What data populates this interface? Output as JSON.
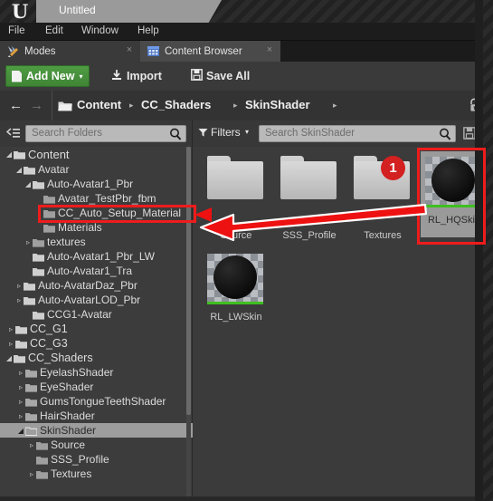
{
  "window": {
    "logo_icon": "unreal-engine-logo",
    "project_tab_title": "Untitled"
  },
  "menu": {
    "items": [
      {
        "label": "File"
      },
      {
        "label": "Edit"
      },
      {
        "label": "Window"
      },
      {
        "label": "Help"
      }
    ]
  },
  "panel_tabs": [
    {
      "label": "Modes",
      "icon": "modes-brush-icon",
      "active": false,
      "close_glyph": "×"
    },
    {
      "label": "Content Browser",
      "icon": "content-browser-grid-icon",
      "active": true,
      "close_glyph": "×"
    }
  ],
  "toolbar": {
    "add_new_label": "Add New",
    "add_new_caret": "▾",
    "import_label": "Import",
    "save_all_label": "Save All"
  },
  "breadcrumb": {
    "back_glyph": "←",
    "forward_glyph": "→",
    "separator": "▸",
    "items": [
      "Content",
      "CC_Shaders",
      "SkinShader"
    ],
    "lock_icon": "padlock-unlocked-icon"
  },
  "folder_search": {
    "placeholder": "Search Folders",
    "tree_toggle_icon": "tree-expand-icon",
    "search_icon": "search-icon"
  },
  "asset_search": {
    "filters_label": "Filters",
    "filters_caret": "▾",
    "filter_icon": "funnel-icon",
    "placeholder": "Search SkinShader",
    "search_icon": "search-icon",
    "save_search_icon": "save-floppy-icon"
  },
  "tree": {
    "items": [
      {
        "label": "Content",
        "depth": 0,
        "twisty": "◢",
        "selected": false
      },
      {
        "label": "Avatar",
        "depth": 1,
        "twisty": "◢",
        "selected": false
      },
      {
        "label": "Auto-Avatar1_Pbr",
        "depth": 2,
        "twisty": "◢",
        "selected": false
      },
      {
        "label": "Avatar_TestPbr_fbm",
        "depth": 3,
        "twisty": "",
        "selected": false
      },
      {
        "label": "CC_Auto_Setup_Material",
        "depth": 3,
        "twisty": "",
        "selected": false,
        "highlighted": true
      },
      {
        "label": "Materials",
        "depth": 3,
        "twisty": "",
        "selected": false
      },
      {
        "label": "textures",
        "depth": 3,
        "twisty": "▹",
        "selected": false
      },
      {
        "label": "Auto-Avatar1_Pbr_LW",
        "depth": 2,
        "twisty": "",
        "selected": false
      },
      {
        "label": "Auto-Avatar1_Tra",
        "depth": 2,
        "twisty": "",
        "selected": false
      },
      {
        "label": "Auto-AvatarDaz_Pbr",
        "depth": 2,
        "twisty": "▹",
        "selected": false
      },
      {
        "label": "Auto-AvatarLOD_Pbr",
        "depth": 2,
        "twisty": "▹",
        "selected": false
      },
      {
        "label": "CCG1-Avatar",
        "depth": 2,
        "twisty": "",
        "selected": false
      },
      {
        "label": "CC_G1",
        "depth": 1,
        "twisty": "▹",
        "selected": false
      },
      {
        "label": "CC_G3",
        "depth": 1,
        "twisty": "▹",
        "selected": false
      },
      {
        "label": "CC_Shaders",
        "depth": 1,
        "twisty": "◢",
        "selected": false
      },
      {
        "label": "EyelashShader",
        "depth": 2,
        "twisty": "▹",
        "selected": false
      },
      {
        "label": "EyeShader",
        "depth": 2,
        "twisty": "▹",
        "selected": false
      },
      {
        "label": "GumsTongueTeethShader",
        "depth": 2,
        "twisty": "▹",
        "selected": false
      },
      {
        "label": "HairShader",
        "depth": 2,
        "twisty": "▹",
        "selected": false
      },
      {
        "label": "SkinShader",
        "depth": 2,
        "twisty": "◢",
        "selected": true
      },
      {
        "label": "Source",
        "depth": 3,
        "twisty": "▹",
        "selected": false
      },
      {
        "label": "SSS_Profile",
        "depth": 3,
        "twisty": "",
        "selected": false
      },
      {
        "label": "Textures",
        "depth": 3,
        "twisty": "▹",
        "selected": false
      }
    ]
  },
  "assets": {
    "folders": [
      {
        "label": "Source"
      },
      {
        "label": "SSS_Profile"
      },
      {
        "label": "Textures"
      }
    ],
    "materials": [
      {
        "label": "RL_HQSkin",
        "selected": true
      },
      {
        "label": "RL_LWSkin",
        "selected": false
      }
    ]
  },
  "annotations": {
    "step_badge": "1",
    "arrow_icon": "red-left-arrow",
    "highlight_color": "#ee1c1c",
    "badge_color": "#d32020"
  },
  "colors": {
    "accent_green": "#4f9c43",
    "thumb_status_green": "#3fbf21",
    "panel_bg": "#3b3b3b",
    "tree_bg": "#3c3c3c"
  }
}
